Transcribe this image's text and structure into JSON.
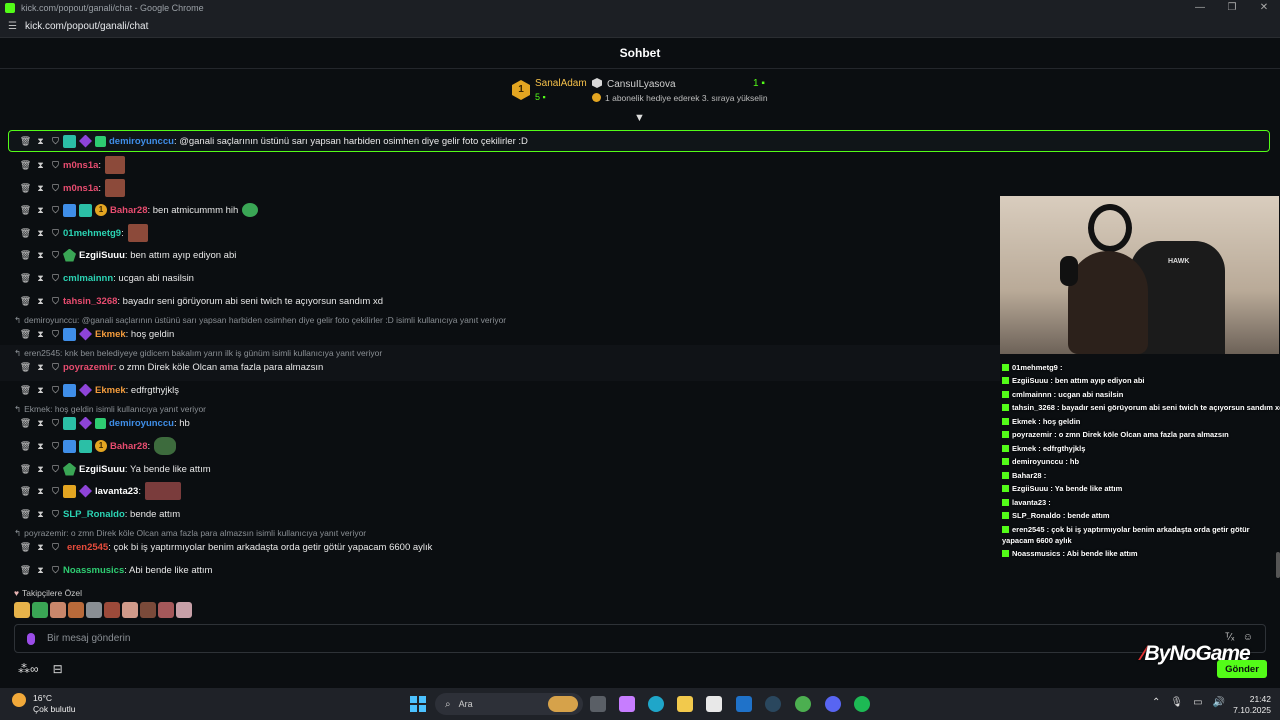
{
  "browser": {
    "title": "kick.com/popout/ganali/chat - Google Chrome",
    "url": "kick.com/popout/ganali/chat"
  },
  "chat": {
    "title": "Sohbet"
  },
  "leaderboard": {
    "rank": "1",
    "top_user": "SanalAdam",
    "top_count": "5",
    "second_user": "CansuILyasova",
    "second_count": "1",
    "promo": "1 abonelik hediye ederek 3. sıraya yükselin"
  },
  "messages": [
    {
      "user": "demiroyunccu",
      "color": "#3f8ee8",
      "text": ": @ganali saçlarının üstünü sarı yapsan harbiden osimhen diye gelir foto çekilirler :D"
    },
    {
      "user": "m0ns1a",
      "color": "#e74c6f",
      "text": ":"
    },
    {
      "user": "m0ns1a",
      "color": "#e74c6f",
      "text": ":"
    },
    {
      "user": "Bahar28",
      "color": "#e74c6f",
      "text": ": ben atmicummm hih"
    },
    {
      "user": "01mehmetg9",
      "color": "#2bd4b4",
      "text": ":"
    },
    {
      "user": "EzgiiSuuu",
      "color": "#ffffff",
      "text": ": ben attım ayıp ediyon abi"
    },
    {
      "user": "cmlmainnn",
      "color": "#2bd4b4",
      "text": ": ucgan abi nasilsin"
    },
    {
      "user": "tahsin_3268",
      "color": "#e74c6f",
      "text": ": bayadır seni görüyorum abi seni twich te açıyorsun sandım xd"
    },
    {
      "user": "Ekmek",
      "color": "#f39c3d",
      "text": ": hoş geldin"
    },
    {
      "user": "poyrazemir",
      "color": "#e74c6f",
      "text": ": o zmn Direk köle Olcan ama fazla para almazsın"
    },
    {
      "user": "Ekmek",
      "color": "#f39c3d",
      "text": ": edfrgthyjklş"
    },
    {
      "user": "demiroyunccu",
      "color": "#3f8ee8",
      "text": ": hb"
    },
    {
      "user": "Bahar28",
      "color": "#e74c6f",
      "text": ":"
    },
    {
      "user": "EzgiiSuuu",
      "color": "#ffffff",
      "text": ": Ya bende like attım"
    },
    {
      "user": "lavanta23",
      "color": "#ffffff",
      "text": ":"
    },
    {
      "user": "SLP_Ronaldo",
      "color": "#2bd4b4",
      "text": ": bende attım"
    },
    {
      "user": "eren2545",
      "color": "#e74c3c",
      "text": ": çok bi iş yaptırmıyolar benim arkadaşta orda getir götür yapacam 6600 aylık"
    },
    {
      "user": "Noassmusics",
      "color": "#2ecc71",
      "text": ": Abi bende like attım"
    }
  ],
  "replies": [
    "demiroyunccu: @ganali saçlarının üstünü sarı yapsan harbiden osimhen diye gelir foto çekilirler :D isimli kullanıcıya yanıt veriyor",
    "eren2545: knk ben belediyeye gidicem bakalım yarın ilk iş günüm isimli kullanıcıya yanıt veriyor",
    "Ekmek: hoş geldin isimli kullanıcıya yanıt veriyor",
    "poyrazemir: o zmn Direk köle Olcan ama fazla para almazsın isimli kullanıcıya yanıt veriyor"
  ],
  "followers_only": "Takipçilere Özel",
  "input": {
    "placeholder": "Bir mesaj gönderin",
    "send_label": "Gönder"
  },
  "watermark": "ByNoGame",
  "cam_logo_text": "HAWK",
  "mini_chat": [
    {
      "user": "01mehmetg9",
      "text": " :"
    },
    {
      "user": "EzgiiSuuu",
      "text": " : ben attım ayıp ediyon abi"
    },
    {
      "user": "cmlmainnn",
      "text": " : ucgan abi nasilsin"
    },
    {
      "user": "tahsin_3268",
      "text": " : bayadır seni görüyorum abi seni twich te açıyorsun sandım xd"
    },
    {
      "user": "Ekmek",
      "text": " : hoş geldin"
    },
    {
      "user": "poyrazemir",
      "text": " : o zmn Direk köle Olcan ama fazla para almazsın"
    },
    {
      "user": "Ekmek",
      "text": " : edfrgthyjklş"
    },
    {
      "user": "demiroyunccu",
      "text": " : hb"
    },
    {
      "user": "Bahar28",
      "text": " :"
    },
    {
      "user": "EzgiiSuuu",
      "text": " : Ya bende like attım"
    },
    {
      "user": "lavanta23",
      "text": " :"
    },
    {
      "user": "SLP_Ronaldo",
      "text": " : bende attım"
    },
    {
      "user": "eren2545",
      "text": " : çok bi iş yaptırmıyolar benim arkadaşta orda getir götür yapacam 6600 aylık"
    },
    {
      "user": "Noassmusics",
      "text": " : Abi bende like attım"
    }
  ],
  "taskbar": {
    "temp": "16°C",
    "condition": "Çok bulutlu",
    "search_label": "Ara",
    "time": "21:42",
    "date": "7.10.2025"
  }
}
